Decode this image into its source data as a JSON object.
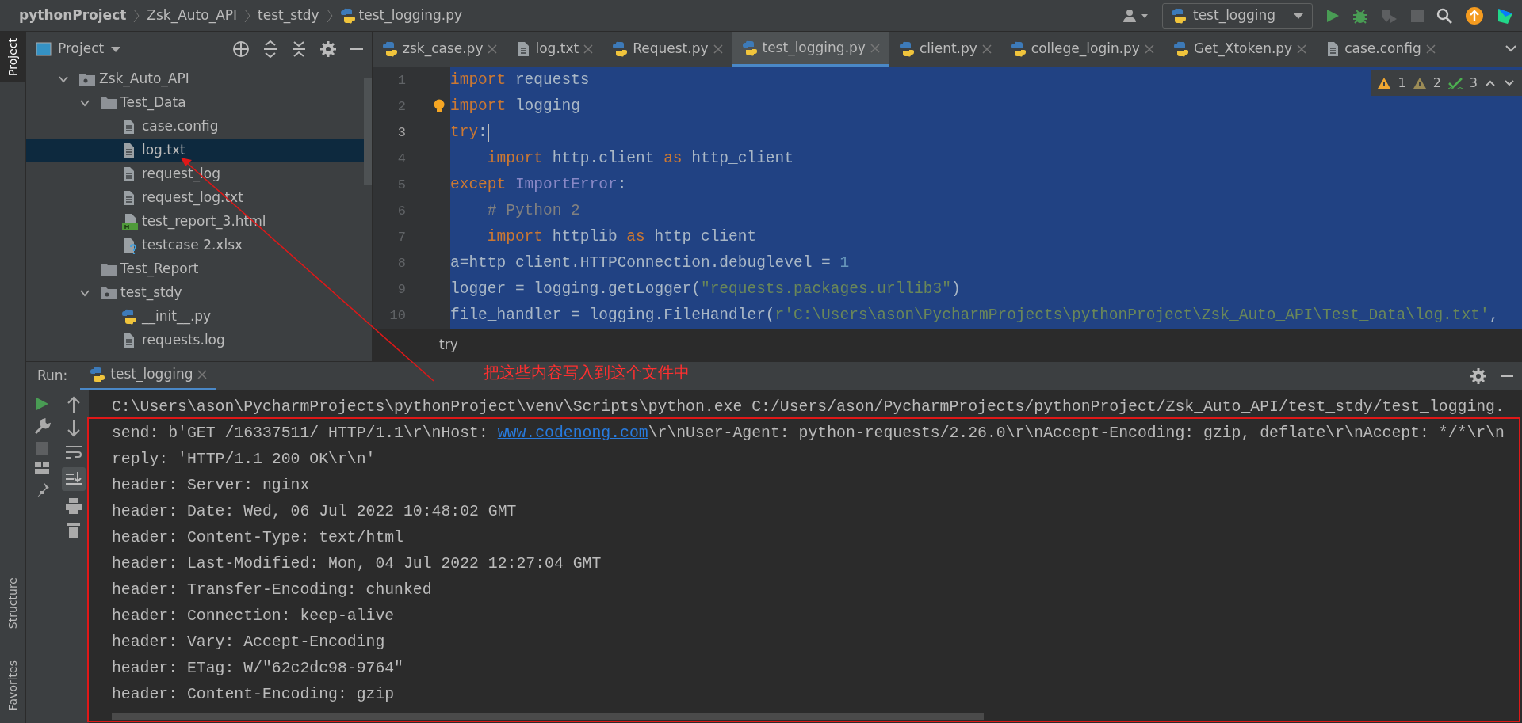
{
  "breadcrumbs": [
    {
      "label": "pythonProject",
      "kind": "project"
    },
    {
      "label": "Zsk_Auto_API",
      "kind": "folder"
    },
    {
      "label": "test_stdy",
      "kind": "folder"
    },
    {
      "label": "test_logging.py",
      "kind": "python"
    }
  ],
  "toolbar": {
    "run_config": "test_logging"
  },
  "side_tabs": {
    "top": [
      {
        "label": "Project",
        "selected": true
      }
    ],
    "bottom": [
      {
        "label": "Structure",
        "selected": false
      },
      {
        "label": "Favorites",
        "selected": false
      }
    ]
  },
  "project_panel": {
    "title": "Project",
    "tree": [
      {
        "label": "Zsk_Auto_API",
        "kind": "module",
        "expanded": true,
        "selected": false,
        "children": [
          {
            "label": "Test_Data",
            "kind": "folder",
            "expanded": true,
            "selected": false,
            "children": [
              {
                "label": "case.config",
                "kind": "text",
                "selected": false
              },
              {
                "label": "log.txt",
                "kind": "text",
                "selected": true
              },
              {
                "label": "request_log",
                "kind": "text",
                "selected": false
              },
              {
                "label": "request_log.txt",
                "kind": "text",
                "selected": false
              },
              {
                "label": "test_report_3.html",
                "kind": "html",
                "selected": false
              },
              {
                "label": "testcase 2.xlsx",
                "kind": "unknown",
                "selected": false
              }
            ]
          },
          {
            "label": "Test_Report",
            "kind": "folder",
            "expanded": false,
            "selected": false
          },
          {
            "label": "test_stdy",
            "kind": "module",
            "expanded": true,
            "selected": false,
            "children": [
              {
                "label": "__init__.py",
                "kind": "python",
                "selected": false
              },
              {
                "label": "requests.log",
                "kind": "text",
                "selected": false
              }
            ]
          }
        ]
      }
    ]
  },
  "editor_tabs": [
    {
      "label": "zsk_case.py",
      "kind": "python",
      "selected": false
    },
    {
      "label": "log.txt",
      "kind": "text",
      "selected": false
    },
    {
      "label": "Request.py",
      "kind": "python",
      "selected": false
    },
    {
      "label": "test_logging.py",
      "kind": "python",
      "selected": true
    },
    {
      "label": "client.py",
      "kind": "python",
      "selected": false
    },
    {
      "label": "college_login.py",
      "kind": "python",
      "selected": false
    },
    {
      "label": "Get_Xtoken.py",
      "kind": "python",
      "selected": false
    },
    {
      "label": "case.config",
      "kind": "text",
      "selected": false
    }
  ],
  "inspections": {
    "warnings": "1",
    "weak_warnings": "2",
    "typos": "3"
  },
  "editor": {
    "lines": [
      {
        "number": "1",
        "current": false,
        "tokens": [
          {
            "kind": "keyword",
            "text": "import"
          },
          {
            "kind": "plain",
            "text": " requests"
          }
        ]
      },
      {
        "number": "2",
        "current": false,
        "tokens": [
          {
            "kind": "keyword",
            "text": "import"
          },
          {
            "kind": "plain",
            "text": " logging"
          }
        ]
      },
      {
        "number": "3",
        "current": true,
        "tokens": [
          {
            "kind": "keyword",
            "text": "try"
          },
          {
            "kind": "plain",
            "text": ":"
          }
        ]
      },
      {
        "number": "4",
        "current": false,
        "indented": true,
        "tokens": [
          {
            "kind": "keyword",
            "text": "import"
          },
          {
            "kind": "plain",
            "text": " http.client "
          },
          {
            "kind": "keyword",
            "text": "as"
          },
          {
            "kind": "plain",
            "text": " http_client"
          }
        ]
      },
      {
        "number": "5",
        "current": false,
        "tokens": [
          {
            "kind": "keyword",
            "text": "except"
          },
          {
            "kind": "builtin",
            "text": " ImportError"
          },
          {
            "kind": "plain",
            "text": ":"
          }
        ]
      },
      {
        "number": "6",
        "current": false,
        "indented": true,
        "tokens": [
          {
            "kind": "comment",
            "text": "# Python 2"
          }
        ]
      },
      {
        "number": "7",
        "current": false,
        "indented": true,
        "tokens": [
          {
            "kind": "keyword",
            "text": "import"
          },
          {
            "kind": "plain",
            "text": " httplib "
          },
          {
            "kind": "keyword",
            "text": "as"
          },
          {
            "kind": "plain",
            "text": " http_client"
          }
        ]
      },
      {
        "number": "8",
        "current": false,
        "tokens": [
          {
            "kind": "plain",
            "text": "a=http_client.HTTPConnection.debuglevel = "
          },
          {
            "kind": "number",
            "text": "1"
          }
        ]
      },
      {
        "number": "9",
        "current": false,
        "tokens": [
          {
            "kind": "plain",
            "text": "logger = logging.getLogger("
          },
          {
            "kind": "string",
            "text": "\"requests.packages.urllib3\""
          },
          {
            "kind": "plain",
            "text": ")"
          }
        ]
      },
      {
        "number": "10",
        "current": false,
        "tokens": [
          {
            "kind": "plain",
            "text": "file_handler = logging.FileHandler("
          },
          {
            "kind": "string",
            "text": "r'C:\\Users\\ason\\PycharmProjects\\pythonProject\\Zsk_Auto_API\\Test_Data\\log.txt'"
          },
          {
            "kind": "plain",
            "text": ","
          }
        ]
      }
    ]
  },
  "code_breadcrumb": "try",
  "run_panel": {
    "label": "Run:",
    "tab": "test_logging",
    "lines": [
      [
        {
          "kind": "plain",
          "text": "C:\\Users\\ason\\PycharmProjects\\pythonProject\\venv\\Scripts\\python.exe C:/Users/ason/PycharmProjects/pythonProject/Zsk_Auto_API/test_stdy/test_logging."
        }
      ],
      [
        {
          "kind": "plain",
          "text": "send: b'GET /16337511/ HTTP/1.1\\r\\nHost: "
        },
        {
          "kind": "link",
          "text": "www.codenong.com"
        },
        {
          "kind": "plain",
          "text": "\\r\\nUser-Agent: python-requests/2.26.0\\r\\nAccept-Encoding: gzip, deflate\\r\\nAccept: */*\\r\\n"
        }
      ],
      [
        {
          "kind": "plain",
          "text": "reply: 'HTTP/1.1 200 OK\\r\\n'"
        }
      ],
      [
        {
          "kind": "plain",
          "text": "header: Server: nginx"
        }
      ],
      [
        {
          "kind": "plain",
          "text": "header: Date: Wed, 06 Jul 2022 10:48:02 GMT"
        }
      ],
      [
        {
          "kind": "plain",
          "text": "header: Content-Type: text/html"
        }
      ],
      [
        {
          "kind": "plain",
          "text": "header: Last-Modified: Mon, 04 Jul 2022 12:27:04 GMT"
        }
      ],
      [
        {
          "kind": "plain",
          "text": "header: Transfer-Encoding: chunked"
        }
      ],
      [
        {
          "kind": "plain",
          "text": "header: Connection: keep-alive"
        }
      ],
      [
        {
          "kind": "plain",
          "text": "header: Vary: Accept-Encoding"
        }
      ],
      [
        {
          "kind": "plain",
          "text": "header: ETag: W/\"62c2dc98-9764\""
        }
      ],
      [
        {
          "kind": "plain",
          "text": "header: Content-Encoding: gzip"
        }
      ]
    ]
  },
  "annotation": {
    "text": "把这些内容写入到这个文件中"
  }
}
